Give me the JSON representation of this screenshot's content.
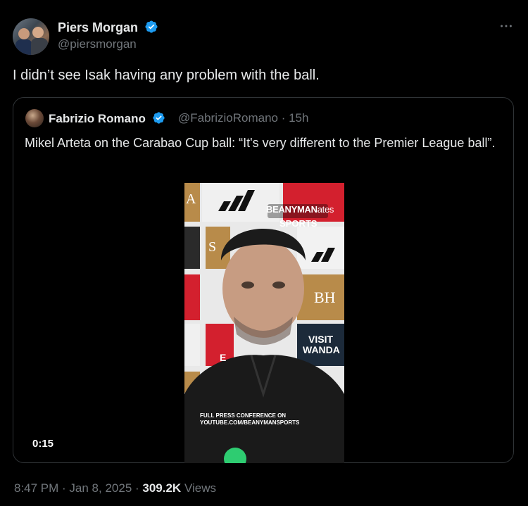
{
  "author": {
    "name": "Piers Morgan",
    "handle": "@piersmorgan"
  },
  "tweet": {
    "text": "I didn’t see Isak having any problem with the ball."
  },
  "quoted": {
    "name": "Fabrizio Romano",
    "handle_time": "@FabrizioRomano · 15h",
    "text": "Mikel Arteta on the Carabao Cup ball: “It's very different to the Premier League ball”.",
    "video": {
      "duration": "0:15",
      "overlay_brand_1": "BEANYMAN",
      "overlay_brand_2": "SPORTS",
      "overlay_caption_1": "FULL PRESS CONFERENCE ON",
      "overlay_caption_2": "YOUTUBE.COM/BEANYMANSPORTS",
      "board_text_1": "VISIT",
      "board_text_2": "WANDA",
      "board_text_3": "BH",
      "board_text_4": "ates",
      "board_text_5": "A",
      "board_text_6": "S",
      "board_text_7": "E"
    }
  },
  "footer": {
    "time": "8:47 PM · Jan 8, 2025 · ",
    "views_count": "309.2K",
    "views_label": " Views"
  },
  "colors": {
    "background": "#000000",
    "text": "#e7e9ea",
    "muted": "#71767b",
    "verified": "#1d9bf0",
    "border": "#2f3336"
  },
  "icons": {
    "verified": "verified-badge-icon",
    "more": "more-horizontal-icon"
  }
}
